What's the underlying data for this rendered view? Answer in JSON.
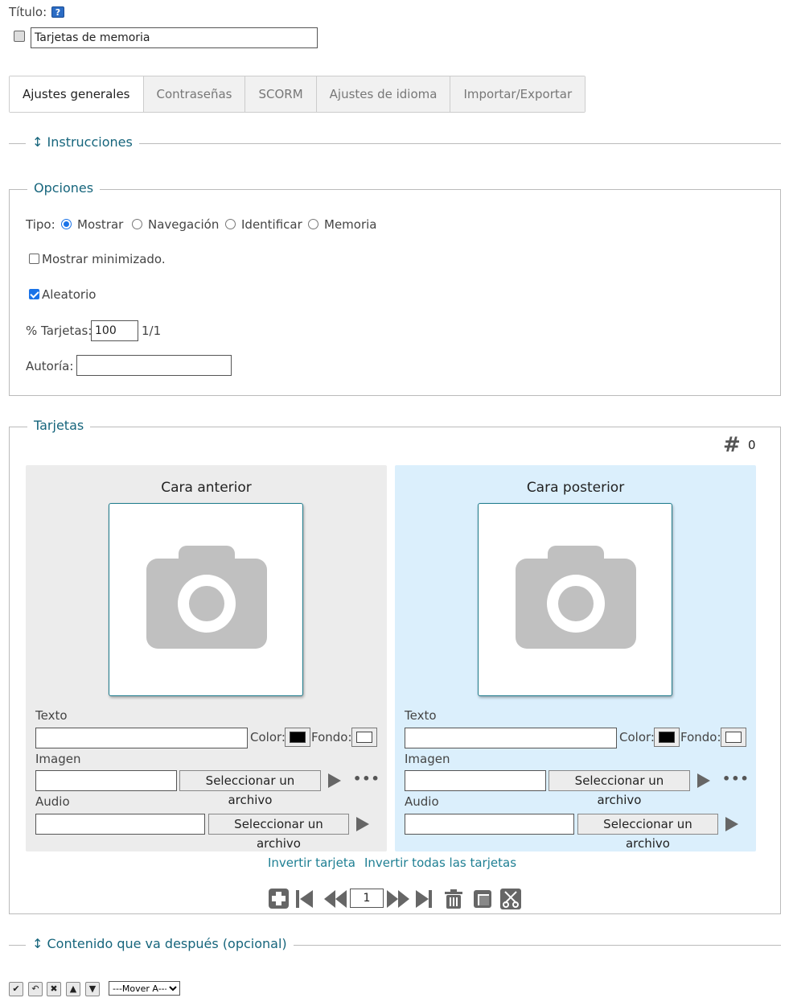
{
  "title_label": "Título:",
  "title_value": "Tarjetas de memoria",
  "tabs": [
    "Ajustes generales",
    "Contraseñas",
    "SCORM",
    "Ajustes de idioma",
    "Importar/Exportar"
  ],
  "instructions_legend": "↕ Instrucciones",
  "options": {
    "legend": "Opciones",
    "tipo_label": "Tipo:",
    "types": [
      {
        "label": "Mostrar",
        "selected": true
      },
      {
        "label": "Navegación",
        "selected": false
      },
      {
        "label": "Identificar",
        "selected": false
      },
      {
        "label": "Memoria",
        "selected": false
      }
    ],
    "minimized_label": "Mostrar minimizado.",
    "minimized_checked": false,
    "random_label": "Aleatorio",
    "random_checked": true,
    "percent_label": "% Tarjetas:",
    "percent_value": "100",
    "percent_ratio": "1/1",
    "author_label": "Autoría:",
    "author_value": ""
  },
  "cards": {
    "legend": "Tarjetas",
    "count": "0",
    "front": {
      "title": "Cara anterior",
      "text_label": "Texto",
      "color_label": "Color:",
      "bg_label": "Fondo:",
      "image_label": "Imagen",
      "select_file": "Seleccionar un archivo",
      "audio_label": "Audio",
      "text_color": "#000000",
      "bg_color": "#ffffff",
      "panel_color": "#ececec"
    },
    "back": {
      "title": "Cara posterior",
      "text_label": "Texto",
      "color_label": "Color:",
      "bg_label": "Fondo:",
      "image_label": "Imagen",
      "select_file": "Seleccionar un archivo",
      "audio_label": "Audio",
      "text_color": "#000000",
      "bg_color": "#ffffff",
      "panel_color": "#dbeffc"
    },
    "invert_card": "Invertir tarjeta",
    "invert_all": "Invertir todas las tarjetas",
    "page_number": "1"
  },
  "after_legend": "↕ Contenido que va después (opcional)",
  "mover_option": "---Mover A---",
  "colors": {
    "accent_link": "#16657c",
    "front_panel": "#ececec",
    "back_panel": "#dbeffc"
  }
}
